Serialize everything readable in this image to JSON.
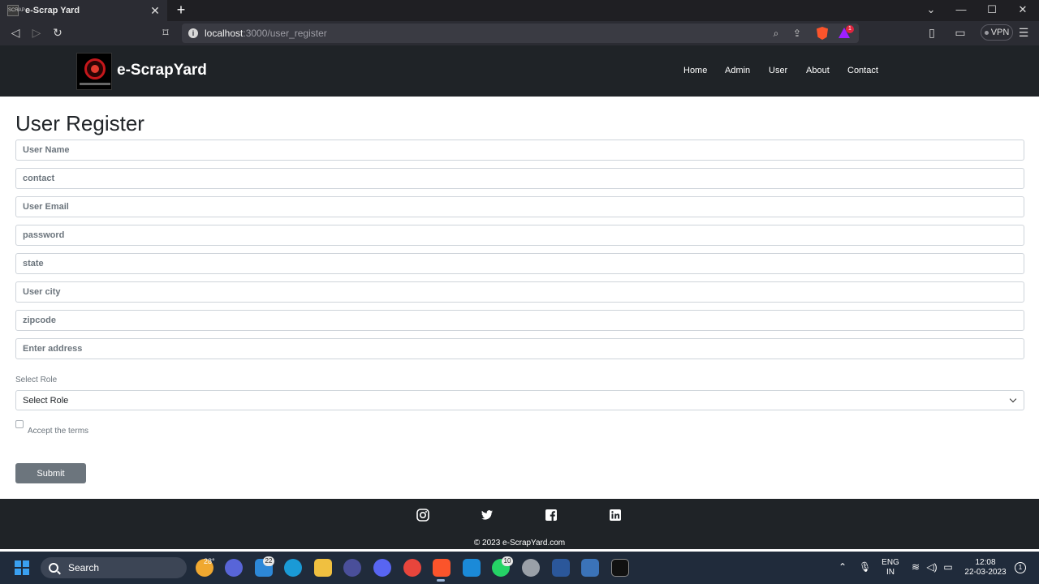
{
  "browser": {
    "tab_title": "e-Scrap Yard",
    "tab_favicon_text": "SCRAP",
    "new_tab": "+",
    "url_host": "localhost",
    "url_path": ":3000/user_register",
    "vpn_label": "VPN",
    "rewards_badge": "1"
  },
  "navbar": {
    "brand": "e-ScrapYard",
    "links": [
      "Home",
      "Admin",
      "User",
      "About",
      "Contact"
    ]
  },
  "form": {
    "title": "User Register",
    "fields": [
      {
        "placeholder": "User Name"
      },
      {
        "placeholder": "contact"
      },
      {
        "placeholder": "User Email"
      },
      {
        "placeholder": "password"
      },
      {
        "placeholder": "state"
      },
      {
        "placeholder": "User city"
      },
      {
        "placeholder": "zipcode"
      },
      {
        "placeholder": "Enter address"
      }
    ],
    "role_label": "Select Role",
    "role_selected": "Select Role",
    "terms_label": "Accept the terms",
    "terms_checked": false,
    "submit_label": "Submit",
    "submit_color": "#6c757d"
  },
  "footer": {
    "social_icons": [
      "instagram-icon",
      "twitter-icon",
      "facebook-icon",
      "linkedin-icon"
    ],
    "copyright": "© 2023 e-ScrapYard.com",
    "background": "#1f2327"
  },
  "taskbar": {
    "search_label": "Search",
    "weather_temp": "28°",
    "mail_badge": "22",
    "whatsapp_badge": "10",
    "lang_top": "ENG",
    "lang_bottom": "IN",
    "time": "12:08",
    "date": "22-03-2023",
    "notification_count": "1"
  }
}
